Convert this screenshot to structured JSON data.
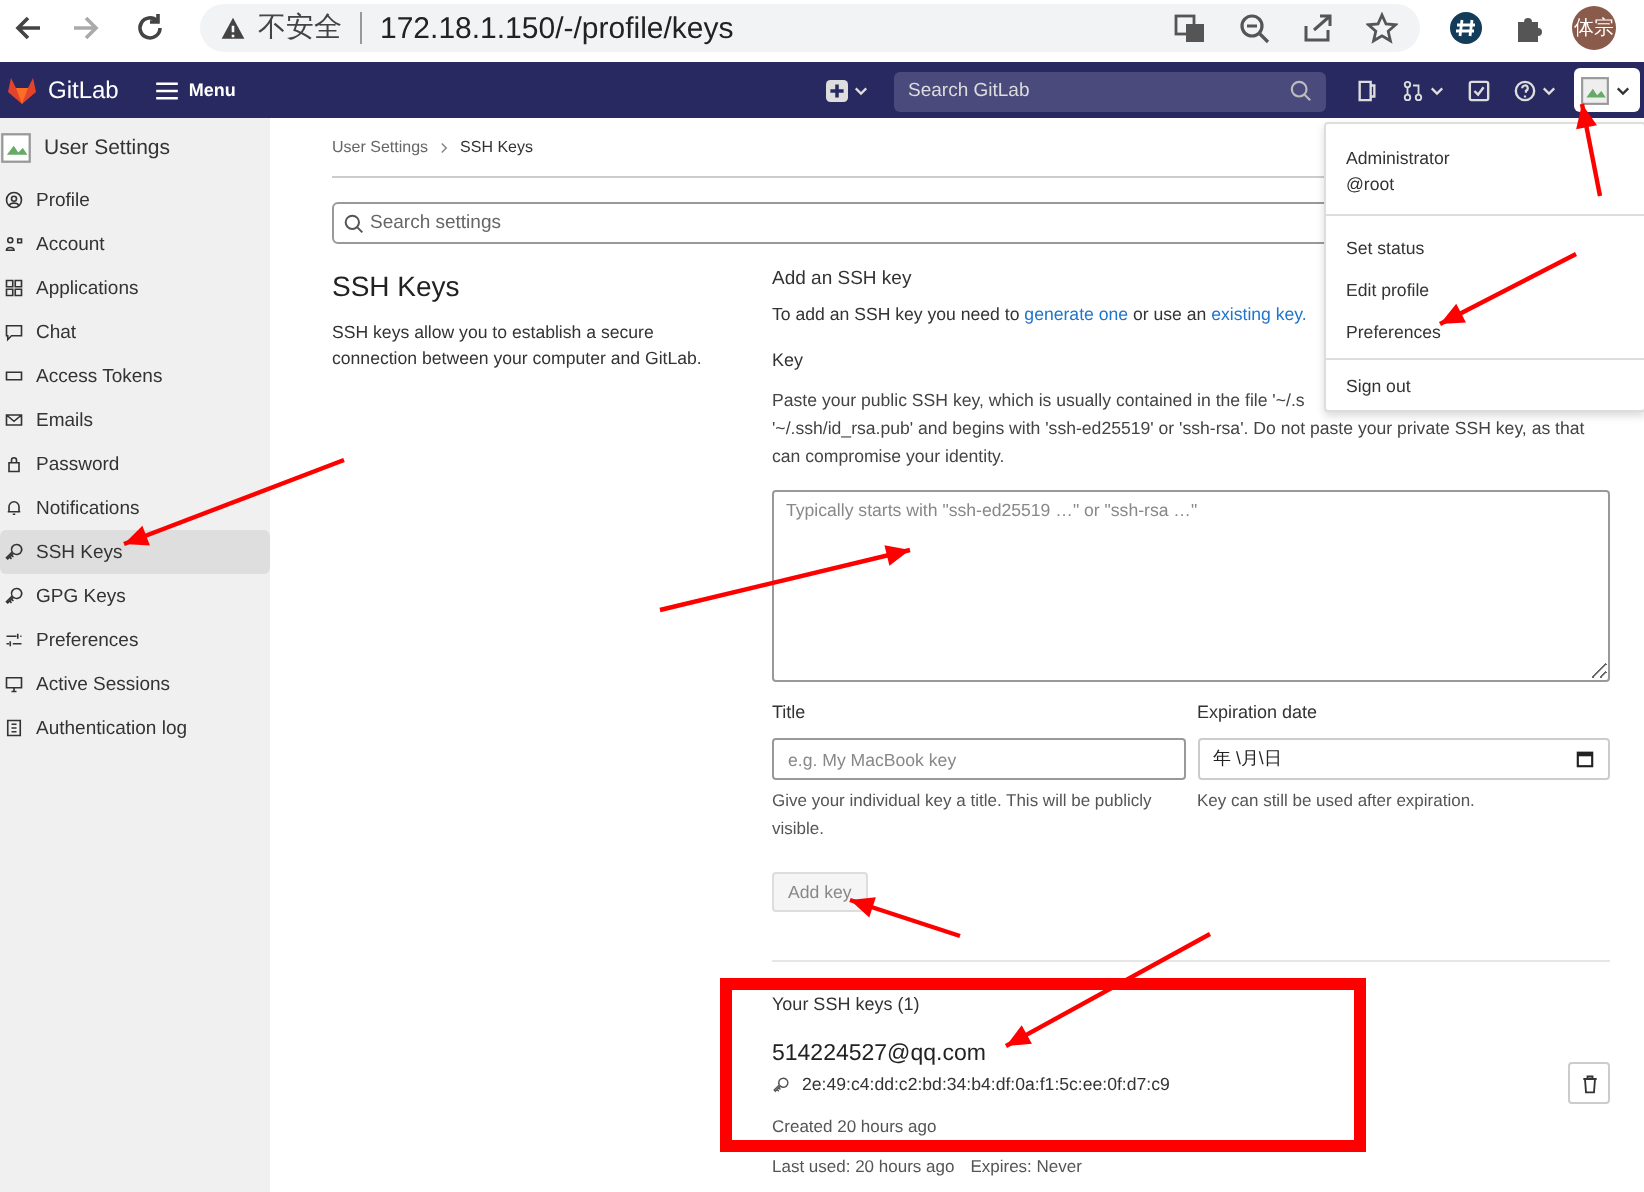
{
  "browser": {
    "security_label": "不安全",
    "url": "172.18.1.150/-/profile/keys",
    "profile_label": "体宗"
  },
  "navbar": {
    "brand": "GitLab",
    "menu": "Menu",
    "search": {
      "placeholder": "Search GitLab"
    }
  },
  "sidebar": {
    "title": "User Settings",
    "items": [
      {
        "label": "Profile",
        "selected": false
      },
      {
        "label": "Account",
        "selected": false
      },
      {
        "label": "Applications",
        "selected": false
      },
      {
        "label": "Chat",
        "selected": false
      },
      {
        "label": "Access Tokens",
        "selected": false
      },
      {
        "label": "Emails",
        "selected": false
      },
      {
        "label": "Password",
        "selected": false
      },
      {
        "label": "Notifications",
        "selected": false
      },
      {
        "label": "SSH Keys",
        "selected": true
      },
      {
        "label": "GPG Keys",
        "selected": false
      },
      {
        "label": "Preferences",
        "selected": false
      },
      {
        "label": "Active Sessions",
        "selected": false
      },
      {
        "label": "Authentication log",
        "selected": false
      }
    ]
  },
  "breadcrumb": [
    "User Settings",
    "SSH Keys"
  ],
  "search_settings": {
    "placeholder": "Search settings"
  },
  "section": {
    "title": "SSH Keys",
    "description": "SSH keys allow you to establish a secure connection between your computer and GitLab."
  },
  "add_key": {
    "heading": "Add an SSH key",
    "intro_before": "To add an SSH key you need to",
    "link_generate": "generate one",
    "intro_middle": "or use an",
    "link_existing": "existing key.",
    "key_label": "Key",
    "key_help_line_1": "Paste your public SSH key, which is usually contained in the file '~/.s",
    "key_help_rest": "'~/.ssh/id_rsa.pub' and begins with 'ssh-ed25519' or 'ssh-rsa'. Do not paste your private SSH key, as that can compromise your identity.",
    "key_placeholder": "Typically starts with \"ssh-ed25519 …\" or \"ssh-rsa …\"",
    "title_label": "Title",
    "title_placeholder": "e.g. My MacBook key",
    "title_help": "Give your individual key a title. This will be publicly visible.",
    "expiration_label": "Expiration date",
    "expiration_value": "年 \\月\\日",
    "expiration_help": "Key can still be used after expiration.",
    "submit": "Add key",
    "submit_disabled": true
  },
  "keys": {
    "heading": "Your SSH keys (1)",
    "items": [
      {
        "title": "514224527@qq.com",
        "fingerprint": "2e:49:c4:dd:c2:bd:34:b4:df:0a:f1:5c:ee:0f:d7:c9",
        "created": "Created 20 hours ago",
        "last_used": "Last used: 20 hours ago",
        "expires": "Expires: Never"
      }
    ]
  },
  "user_menu": {
    "name": "Administrator",
    "username": "@root",
    "items": [
      {
        "label": "Set status"
      },
      {
        "label": "Edit profile"
      },
      {
        "label": "Preferences"
      },
      {
        "label": "Sign out"
      }
    ]
  }
}
